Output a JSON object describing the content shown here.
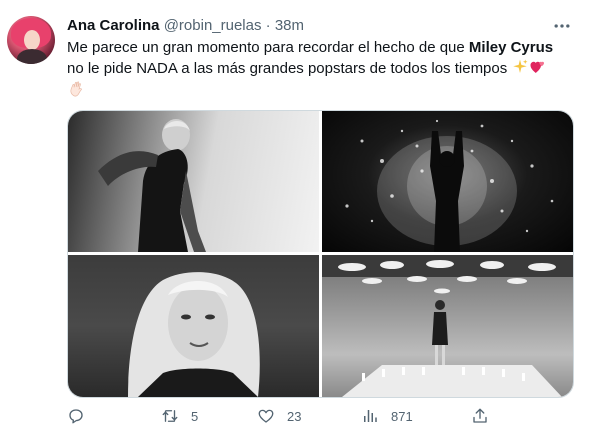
{
  "tweet": {
    "author_name": "Ana Carolina",
    "handle": "@robin_ruelas",
    "separator": "·",
    "time": "38m",
    "text_part1": "Me parece un gran momento para recordar el hecho de que ",
    "text_bold": "Miley Cyrus",
    "text_part2": " no le pide NADA a las más grandes popstars de todos los tiempos ",
    "emojis": [
      "sparkles-icon",
      "two-hearts-icon",
      "waving-hand-icon"
    ]
  },
  "actions": {
    "reply_count": "",
    "retweet_count": "5",
    "like_count": "23",
    "views_count": "871"
  },
  "media": {
    "count": 4
  }
}
